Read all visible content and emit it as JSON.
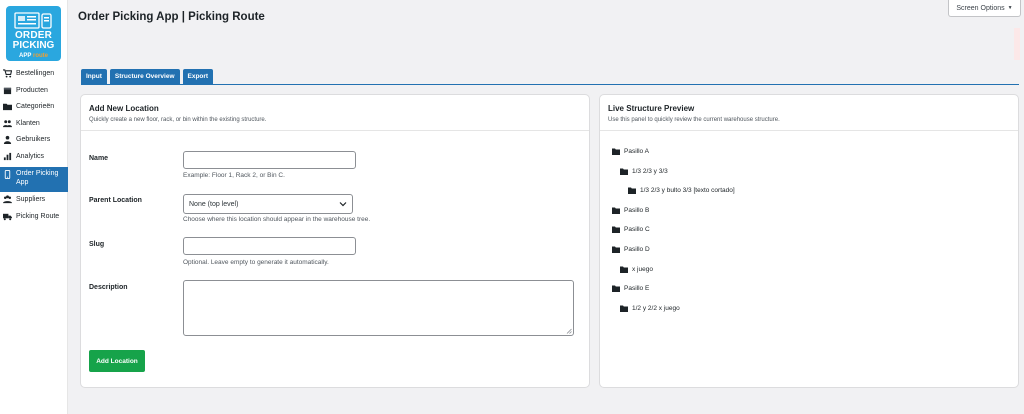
{
  "logo": {
    "line1": "ORDER",
    "line2": "PICKING",
    "line3a": "APP",
    "line3b": "route"
  },
  "sidebar": {
    "items": [
      {
        "label": "Bestellingen",
        "icon": "cart-icon"
      },
      {
        "label": "Producten",
        "icon": "box-icon"
      },
      {
        "label": "Categorieën",
        "icon": "folder-icon"
      },
      {
        "label": "Klanten",
        "icon": "users-icon"
      },
      {
        "label": "Gebruikers",
        "icon": "user-icon"
      },
      {
        "label": "Analytics",
        "icon": "bar-chart-icon"
      },
      {
        "label": "Order Picking App",
        "icon": "phone-icon",
        "active": true
      },
      {
        "label": "Suppliers",
        "icon": "suppliers-icon"
      },
      {
        "label": "Picking Route",
        "icon": "truck-icon"
      }
    ]
  },
  "header": {
    "title": "Order Picking App | Picking Route",
    "screen_options": "Screen Options"
  },
  "tabs": [
    "Input",
    "Structure Overview",
    "Export"
  ],
  "form": {
    "title": "Add New Location",
    "subtitle": "Quickly create a new floor, rack, or bin within the existing structure.",
    "name_label": "Name",
    "name_value": "",
    "name_help": "Example: Floor 1, Rack 2, or Bin C.",
    "parent_label": "Parent Location",
    "parent_value": "None (top level)",
    "parent_help": "Choose where this location should appear in the warehouse tree.",
    "slug_label": "Slug",
    "slug_value": "",
    "slug_help": "Optional. Leave empty to generate it automatically.",
    "description_label": "Description",
    "description_value": "",
    "submit_label": "Add Location"
  },
  "preview": {
    "title": "Live Structure Preview",
    "subtitle": "Use this panel to quickly review the current warehouse structure.",
    "tree": [
      {
        "label": "Pasillo A",
        "depth": 0
      },
      {
        "label": "1/3 2/3 y 3/3",
        "depth": 1
      },
      {
        "label": "1/3 2/3 y bulto 3/3 [texto cortado]",
        "depth": 2
      },
      {
        "label": "Pasillo B",
        "depth": 0
      },
      {
        "label": "Pasillo C",
        "depth": 0
      },
      {
        "label": "Pasillo D",
        "depth": 0
      },
      {
        "label": "x juego",
        "depth": 1
      },
      {
        "label": "Pasillo E",
        "depth": 0
      },
      {
        "label": "1/2 y 2/2 x juego",
        "depth": 1
      }
    ]
  },
  "colors": {
    "accent": "#2271b1",
    "button": "#16a34a",
    "logo_bg": "#2aa7df"
  }
}
